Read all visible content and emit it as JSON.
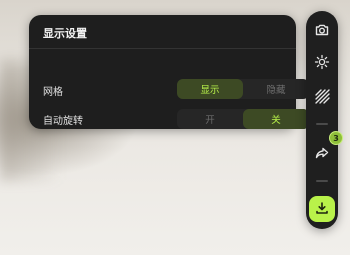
{
  "panel": {
    "title": "显示设置",
    "rows": [
      {
        "label": "网格",
        "options": [
          "显示",
          "隐藏"
        ],
        "selected": "显示"
      },
      {
        "label": "自动旋转",
        "options": [
          "开",
          "关"
        ],
        "selected": "关"
      }
    ]
  },
  "toolbar": {
    "icons": [
      "camera-icon",
      "sun-icon",
      "hatch-icon",
      "share-icon",
      "download-icon"
    ],
    "badge_text": "3",
    "accent_color": "#b9f24a"
  }
}
